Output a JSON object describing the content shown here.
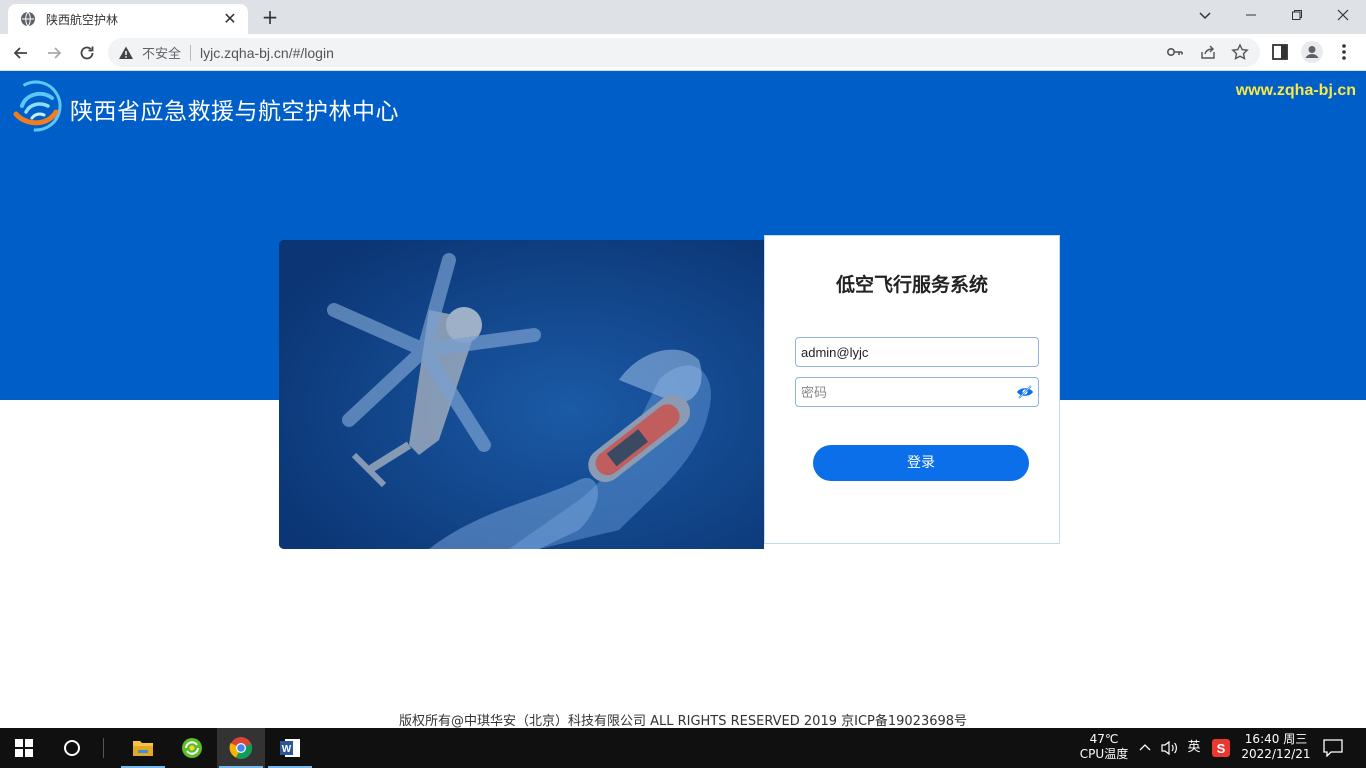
{
  "browser": {
    "tab_title": "陕西航空护林",
    "tab_close": "✕",
    "new_tab": "+",
    "security_label": "不安全",
    "url": "lyjc.zqha-bj.cn/#/login"
  },
  "header": {
    "site_title": "陕西省应急救援与航空护林中心",
    "site_url": "www.zqha-bj.cn"
  },
  "login": {
    "title": "低空飞行服务系统",
    "username_value": "admin@lyjc",
    "password_placeholder": "密码",
    "submit_label": "登录"
  },
  "footer": {
    "copyright": "版权所有@中琪华安（北京）科技有限公司 ALL RIGHTS RESERVED  2019  京ICP备19023698号"
  },
  "taskbar": {
    "temperature": "47℃",
    "temperature_label": "CPU温度",
    "ime": "英",
    "time": "16:40 周三",
    "date": "2022/12/21"
  },
  "colors": {
    "hero_blue": "#005ec9",
    "accent_blue": "#0a6fe8",
    "url_yellow": "#f7e948"
  }
}
